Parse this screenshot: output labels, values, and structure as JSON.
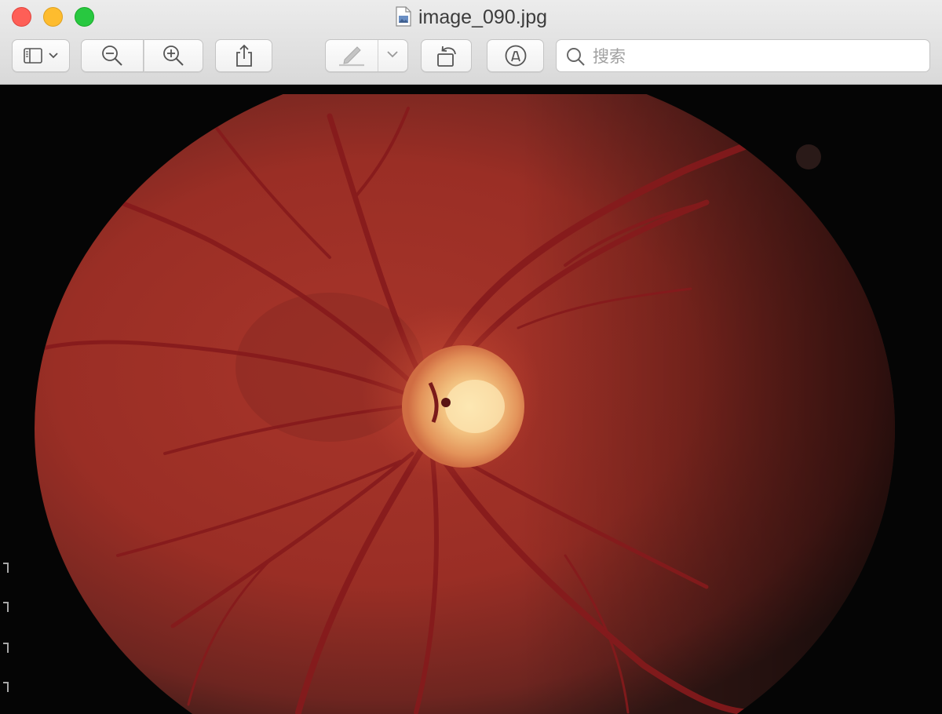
{
  "window": {
    "title": "image_090.jpg",
    "title_icon": "jpeg-document-icon"
  },
  "toolbar": {
    "sidebar_button_icon": "sidebar-icon",
    "zoom_out_icon": "zoom-out-icon",
    "zoom_in_icon": "zoom-in-icon",
    "share_icon": "share-icon",
    "markup_icon": "pen-icon",
    "rotate_icon": "rotate-left-icon",
    "annotate_icon": "markup-circle-icon",
    "search": {
      "placeholder": "搜索",
      "value": ""
    }
  },
  "colors": {
    "traffic_close": "#fe5f57",
    "traffic_minimize": "#febc2e",
    "traffic_maximize": "#28c840",
    "fundus_red": "#9e2b22",
    "optic_disc": "#f4c98a"
  }
}
